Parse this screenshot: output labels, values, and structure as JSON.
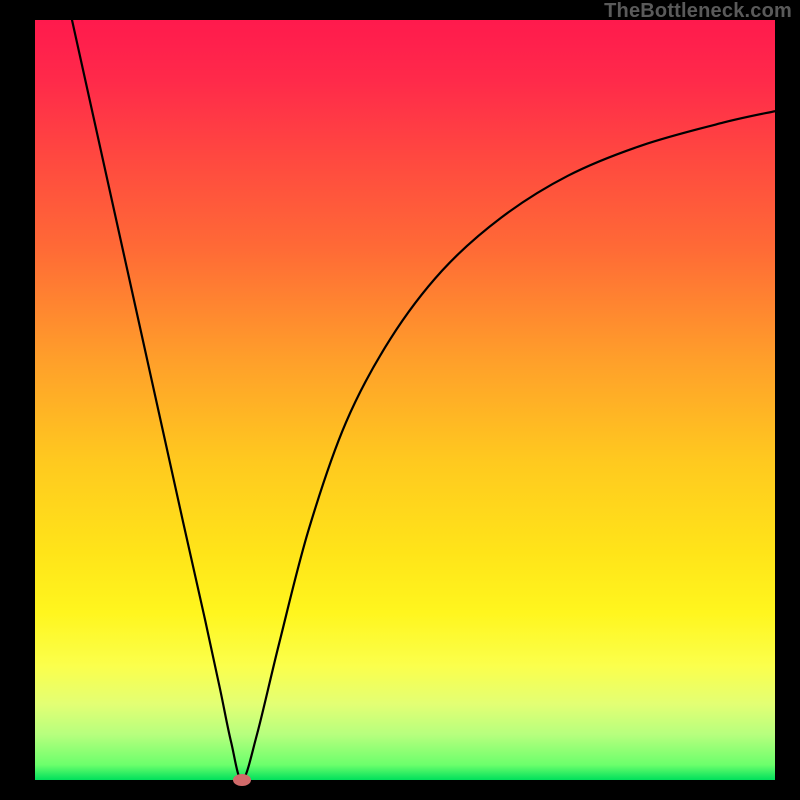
{
  "watermark": "TheBottleneck.com",
  "chart_data": {
    "type": "line",
    "title": "",
    "xlabel": "",
    "ylabel": "",
    "xlim": [
      0,
      100
    ],
    "ylim": [
      0,
      100
    ],
    "series": [
      {
        "name": "bottleneck-curve",
        "x": [
          5,
          10,
          15,
          20,
          23,
          25,
          26.5,
          28,
          30,
          33,
          37,
          42,
          48,
          55,
          63,
          72,
          82,
          93,
          100
        ],
        "y": [
          100,
          78,
          56,
          34,
          21,
          12,
          5,
          0,
          6,
          18,
          33,
          47,
          58,
          67,
          74,
          79.5,
          83.5,
          86.5,
          88
        ]
      }
    ],
    "marker": {
      "x": 28,
      "y": 0
    },
    "gradient_stops": [
      {
        "pos": 0,
        "color": "#ff1a4d"
      },
      {
        "pos": 50,
        "color": "#ffc21f"
      },
      {
        "pos": 85,
        "color": "#fcff40"
      },
      {
        "pos": 100,
        "color": "#00e05c"
      }
    ]
  }
}
